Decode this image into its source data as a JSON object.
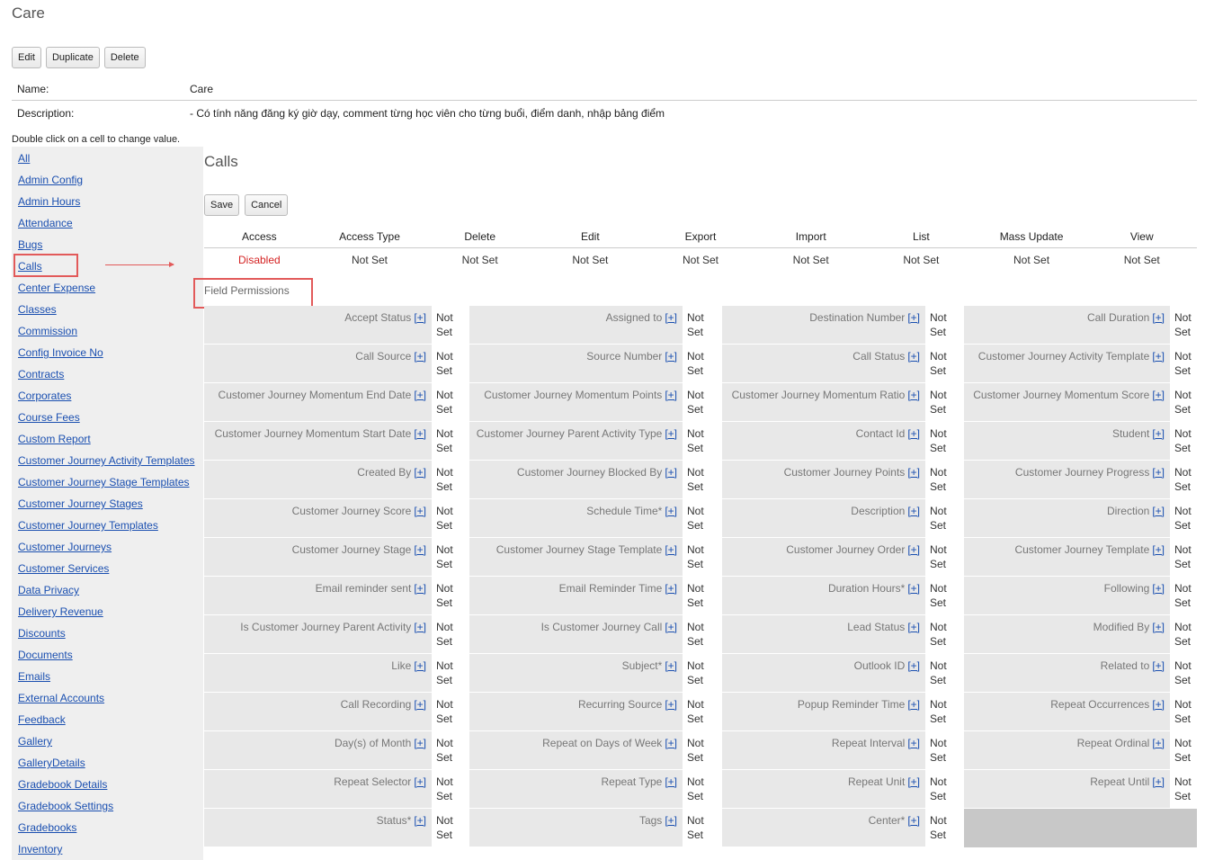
{
  "page": {
    "title": "Care",
    "buttons": {
      "edit": "Edit",
      "duplicate": "Duplicate",
      "delete": "Delete"
    },
    "name_label": "Name:",
    "name_value": "Care",
    "description_label": "Description:",
    "description_value": "- Có tính năng đăng ký giờ dạy, comment từng học viên cho từng buổi, điểm danh, nhập bảng điểm",
    "hint": "Double click on a cell to change value."
  },
  "sidebar": {
    "items": [
      "All",
      "Admin Config",
      "Admin Hours",
      "Attendance",
      "Bugs",
      "Calls",
      "Center Expense",
      "Classes",
      "Commission",
      "Config Invoice No",
      "Contracts",
      "Corporates",
      "Course Fees",
      "Custom Report",
      "Customer Journey Activity Templates",
      "Customer Journey Stage Templates",
      "Customer Journey Stages",
      "Customer Journey Templates",
      "Customer Journeys",
      "Customer Services",
      "Data Privacy",
      "Delivery Revenue",
      "Discounts",
      "Documents",
      "Emails",
      "External Accounts",
      "Feedback",
      "Gallery",
      "GalleryDetails",
      "Gradebook Details",
      "Gradebook Settings",
      "Gradebooks",
      "Inventory"
    ],
    "selected": "Calls",
    "highlight_color": "#e25a5a"
  },
  "module": {
    "title": "Calls",
    "save": "Save",
    "cancel": "Cancel",
    "headers": [
      "Access",
      "Access Type",
      "Delete",
      "Edit",
      "Export",
      "Import",
      "List",
      "Mass Update",
      "View"
    ],
    "values": [
      "Disabled",
      "Not Set",
      "Not Set",
      "Not Set",
      "Not Set",
      "Not Set",
      "Not Set",
      "Not Set",
      "Not Set"
    ],
    "disabled_color": "#d42222"
  },
  "fields": {
    "section_label": "Field Permissions",
    "plus": "[+]",
    "value_line1": "Not",
    "value_line2": "Set",
    "rows": [
      [
        "Accept Status",
        "Assigned to",
        "Destination Number",
        "Call Duration"
      ],
      [
        "Call Source",
        "Source Number",
        "Call Status",
        "Customer Journey Activity Template"
      ],
      [
        "Customer Journey Momentum End Date",
        "Customer Journey Momentum Points",
        "Customer Journey Momentum Ratio",
        "Customer Journey Momentum Score"
      ],
      [
        "Customer Journey Momentum Start Date",
        "Customer Journey Parent Activity Type",
        "Contact Id",
        "Student"
      ],
      [
        "Created By",
        "Customer Journey Blocked By",
        "Customer Journey Points",
        "Customer Journey Progress"
      ],
      [
        "Customer Journey Score",
        "Schedule Time*",
        "Description",
        "Direction"
      ],
      [
        "Customer Journey Stage",
        "Customer Journey Stage Template",
        "Customer Journey Order",
        "Customer Journey Template"
      ],
      [
        "Email reminder sent",
        "Email Reminder Time",
        "Duration Hours*",
        "Following"
      ],
      [
        "Is Customer Journey Parent Activity",
        "Is Customer Journey Call",
        "Lead Status",
        "Modified By"
      ],
      [
        "Like",
        "Subject*",
        "Outlook ID",
        "Related to"
      ],
      [
        "Call Recording",
        "Recurring Source",
        "Popup Reminder Time",
        "Repeat Occurrences"
      ],
      [
        "Day(s) of Month",
        "Repeat on Days of Week",
        "Repeat Interval",
        "Repeat Ordinal"
      ],
      [
        "Repeat Selector",
        "Repeat Type",
        "Repeat Unit",
        "Repeat Until"
      ],
      [
        "Status*",
        "Tags",
        "Center*",
        ""
      ]
    ]
  }
}
